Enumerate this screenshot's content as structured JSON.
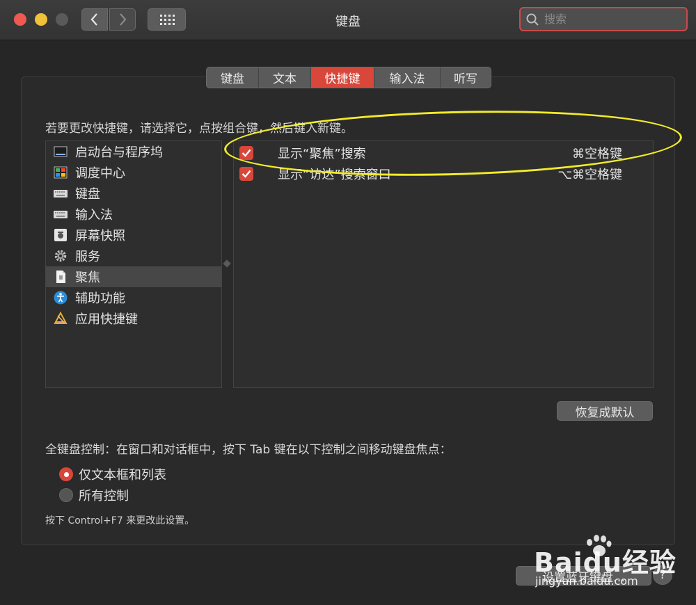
{
  "window": {
    "title": "键盘",
    "search_placeholder": "搜索"
  },
  "tabs": [
    {
      "label": "键盘",
      "active": false
    },
    {
      "label": "文本",
      "active": false
    },
    {
      "label": "快捷键",
      "active": true
    },
    {
      "label": "输入法",
      "active": false
    },
    {
      "label": "听写",
      "active": false
    }
  ],
  "instruction": "若要更改快捷键，请选择它，点按组合键，然后键入新键。",
  "categories": [
    {
      "label": "启动台与程序坞",
      "icon": "dock-icon"
    },
    {
      "label": "调度中心",
      "icon": "mission-control-icon"
    },
    {
      "label": "键盘",
      "icon": "keyboard-icon"
    },
    {
      "label": "输入法",
      "icon": "keyboard-icon"
    },
    {
      "label": "屏幕快照",
      "icon": "screenshot-icon"
    },
    {
      "label": "服务",
      "icon": "gear-icon"
    },
    {
      "label": "聚焦",
      "icon": "document-icon",
      "selected": true
    },
    {
      "label": "辅助功能",
      "icon": "accessibility-icon"
    },
    {
      "label": "应用快捷键",
      "icon": "app-shortcuts-icon"
    }
  ],
  "shortcuts": [
    {
      "label": "显示“聚焦”搜索",
      "key": "⌘空格键",
      "checked": true
    },
    {
      "label": "显示“访达”搜索窗口",
      "key": "⌥⌘空格键",
      "checked": true
    }
  ],
  "restore_button": "恢复成默认",
  "full_keyboard": {
    "label": "全键盘控制：在窗口和对话框中，按下 Tab 键在以下控制之间移动键盘焦点：",
    "options": [
      {
        "label": "仅文本框和列表",
        "selected": true
      },
      {
        "label": "所有控制",
        "selected": false
      }
    ],
    "hint": "按下 Control+F7 来更改此设置。"
  },
  "bluetooth_button": "设置蓝牙键盘…",
  "help_label": "?",
  "watermark": {
    "brand": "Baidu经验",
    "url": "jingyan.baidu.com"
  },
  "colors": {
    "accent": "#d8473a",
    "annotation": "#f2ec2a"
  }
}
